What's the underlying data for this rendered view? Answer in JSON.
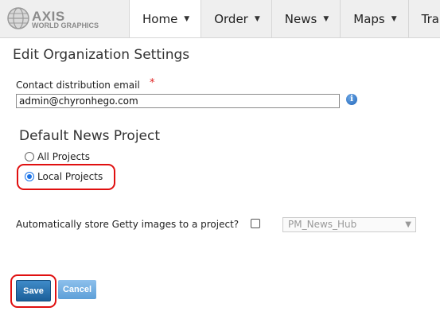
{
  "logo": {
    "name": "AXIS",
    "subtitle": "WORLD GRAPHICS"
  },
  "nav": {
    "items": [
      {
        "label": "Home",
        "active": true
      },
      {
        "label": "Order",
        "active": false
      },
      {
        "label": "News",
        "active": false
      },
      {
        "label": "Maps",
        "active": false
      },
      {
        "label": "Tra",
        "active": false
      }
    ]
  },
  "page": {
    "title": "Edit Organization Settings"
  },
  "email": {
    "label": "Contact distribution email",
    "required_mark": "*",
    "value": "admin@chyronhego.com",
    "info_icon": "info-icon"
  },
  "news_project": {
    "title": "Default News Project",
    "options": [
      {
        "label": "All Projects",
        "selected": false
      },
      {
        "label": "Local Projects",
        "selected": true
      }
    ]
  },
  "getty": {
    "label": "Automatically store Getty images to a project?",
    "checked": false,
    "select_value": "PM_News_Hub"
  },
  "buttons": {
    "save": "Save",
    "cancel": "Cancel"
  },
  "colors": {
    "highlight": "#e01010",
    "save_bg": "#1b5f99",
    "cancel_bg": "#5d9fd8",
    "radio_accent": "#1a73e8"
  }
}
